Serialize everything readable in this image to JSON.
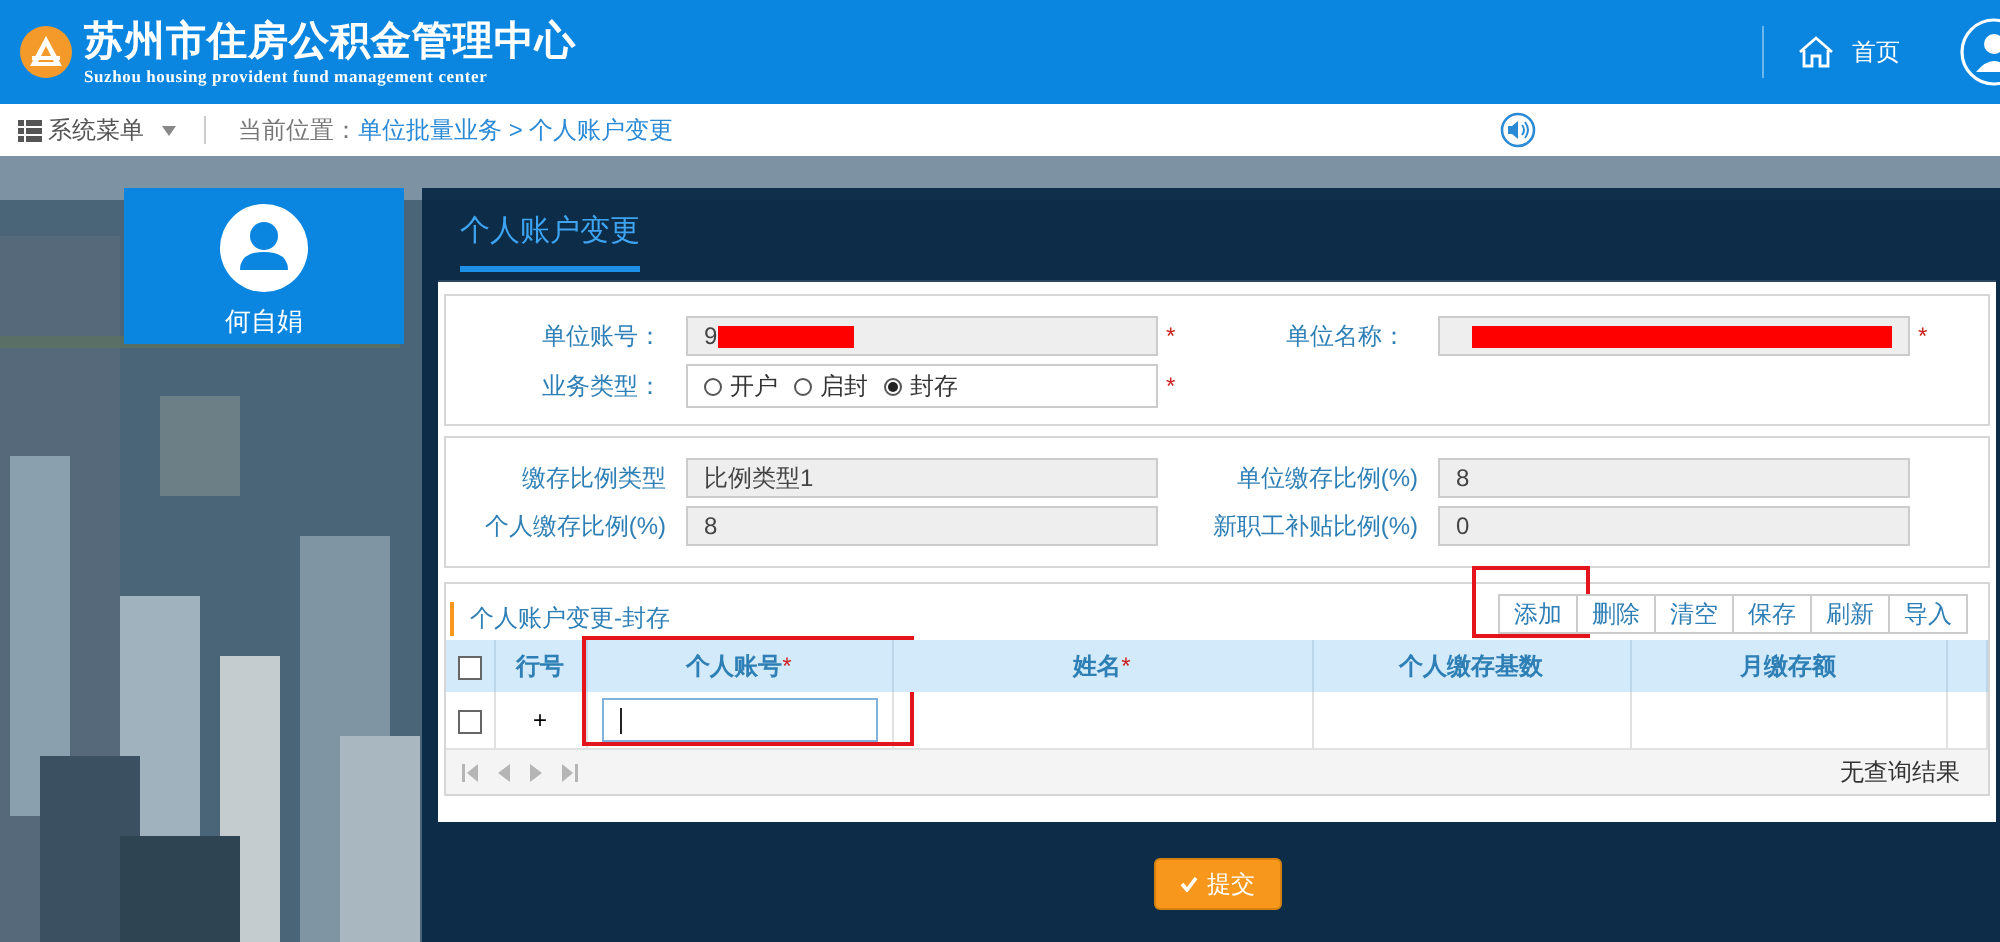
{
  "header": {
    "title": "苏州市住房公积金管理中心",
    "subtitle": "Suzhou housing provident fund management center",
    "home": "首页"
  },
  "breadcrumb": {
    "menu": "系统菜单",
    "label": "当前位置：",
    "path": "单位批量业务 > 个人账户变更"
  },
  "user": {
    "name": "何自娟"
  },
  "tabs": [
    {
      "label": "个人账户变更",
      "selected": true
    }
  ],
  "unit_form": {
    "fields": [
      {
        "label": "单位账号：",
        "value": "9",
        "required_mark": "*",
        "redacted": true
      },
      {
        "label": "单位名称：",
        "required_mark": "*",
        "redacted": true
      }
    ],
    "business_type": {
      "label": "业务类型：",
      "required_mark": "*",
      "options": [
        {
          "label": "开户",
          "selected": false
        },
        {
          "label": "启封",
          "selected": false
        },
        {
          "label": "封存",
          "selected": true
        }
      ]
    }
  },
  "ratio_form": {
    "fields": [
      {
        "label": "缴存比例类型",
        "value": "比例类型1"
      },
      {
        "label": "单位缴存比例(%)",
        "value": "8"
      },
      {
        "label": "个人缴存比例(%)",
        "value": "8"
      },
      {
        "label": "新职工补贴比例(%)",
        "value": "0"
      }
    ]
  },
  "grid": {
    "title": "个人账户变更-封存",
    "buttons": [
      {
        "label": "添加",
        "highlighted": true
      },
      {
        "label": "删除",
        "highlighted": false
      },
      {
        "label": "清空",
        "highlighted": false
      },
      {
        "label": "保存",
        "highlighted": false
      },
      {
        "label": "刷新",
        "highlighted": false
      },
      {
        "label": "导入",
        "highlighted": false
      }
    ],
    "header_checked": false,
    "columns": [
      {
        "label": "行号",
        "highlighted": false
      },
      {
        "label": "个人账号",
        "required_mark": "*",
        "highlighted": true
      },
      {
        "label": "姓名",
        "required_mark": "*",
        "highlighted": false
      },
      {
        "label": "个人缴存基数",
        "highlighted": false
      },
      {
        "label": "月缴存额",
        "highlighted": false
      }
    ],
    "rows": [
      {
        "checked": false,
        "row_number": "+",
        "editing": true
      }
    ],
    "empty_message": "无查询结果"
  },
  "submit": "提交"
}
